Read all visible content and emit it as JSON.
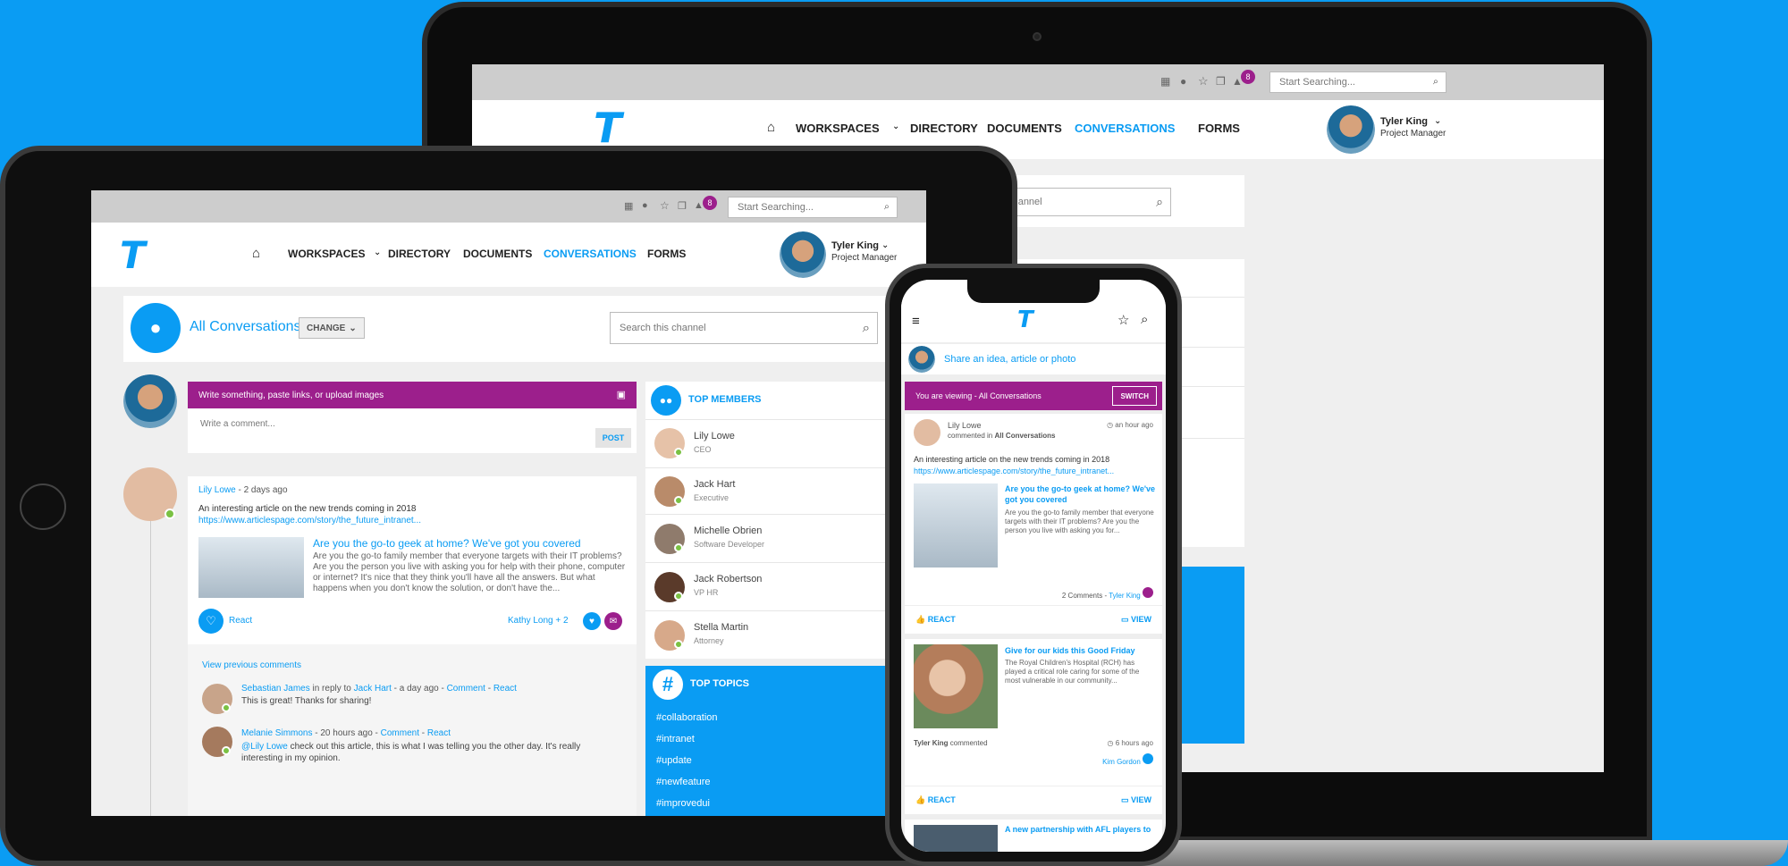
{
  "header": {
    "search_placeholder": "Start Searching...",
    "notification_count": "8",
    "nav": [
      "WORKSPACES",
      "DIRECTORY",
      "DOCUMENTS",
      "CONVERSATIONS",
      "FORMS"
    ],
    "active_nav": "CONVERSATIONS",
    "user_name": "Tyler King",
    "user_role": "Project Manager"
  },
  "channel": {
    "title": "All Conversations",
    "change_label": "CHANGE",
    "search_placeholder": "Search this channel"
  },
  "composer": {
    "prompt": "Write something, paste links, or upload images",
    "comment_placeholder": "Write a comment...",
    "post_label": "POST"
  },
  "post": {
    "author": "Lily Lowe",
    "time": " - 2 days ago",
    "text": "An interesting article on the new trends coming in 2018",
    "url": "https://www.articlespage.com/story/the_future_intranet...",
    "article_title": "Are you the go-to geek at home? We've got you covered",
    "article_body": "Are you the go-to family member that everyone targets with their IT problems? Are you the person you live with asking you for help with their phone, computer or internet? It's nice that they think you'll have all the answers. But what happens when you don't know the solution, or don't have the...",
    "react_label": "React",
    "reactors": "Kathy Long + 2",
    "view_previous": "View previous comments",
    "comments": [
      {
        "author": "Sebastian James",
        "reply_text": " in reply to ",
        "reply_to": "Jack Hart",
        "meta": " - a day ago - ",
        "comment_link": "Comment",
        "dash": " - ",
        "react_link": "React",
        "text": "This is great! Thanks for sharing!"
      },
      {
        "author": "Melanie Simmons",
        "meta": " - 20 hours ago - ",
        "comment_link": "Comment",
        "dash": " - ",
        "react_link": "React",
        "mention": "@Lily Lowe",
        "text": " check out this article, this is what I was telling you the other day. It's really interesting in my opinion."
      }
    ]
  },
  "top_members": {
    "title": "TOP MEMBERS",
    "members": [
      {
        "name": "Lily Lowe",
        "role": "CEO"
      },
      {
        "name": "Jack Hart",
        "role": "Executive"
      },
      {
        "name": "Michelle Obrien",
        "role": "Software Developer"
      },
      {
        "name": "Jack Robertson",
        "role": "VP HR"
      },
      {
        "name": "Stella Martin",
        "role": "Attorney"
      }
    ]
  },
  "top_topics": {
    "title": "TOP TOPICS",
    "topics": [
      "#collaboration",
      "#intranet",
      "#update",
      "#newfeature",
      "#improvedui"
    ]
  },
  "mobile": {
    "share_prompt": "Share an idea, article or photo",
    "viewing_text": "You are viewing - All Conversations",
    "switch_label": "SWITCH",
    "post1": {
      "author": "Lily Lowe",
      "action": "commented in ",
      "channel": "All Conversations",
      "time": "an hour ago",
      "text": "An interesting article on the new trends coming in 2018",
      "url": "https://www.articlespage.com/story/the_future_intranet...",
      "article_title": "Are you the go-to geek at home? We've got you covered",
      "article_body": "Are you the go-to family member that everyone targets with their IT problems? Are you the person you live with asking you for...",
      "comments": "2 Comments - ",
      "commenter": "Tyler King"
    },
    "react_label": "REACT",
    "view_label": "VIEW",
    "post2": {
      "article_title": "Give for our kids this Good Friday",
      "article_body": "The Royal Children's Hospital (RCH) has played a critical role caring for some of the most vulnerable in our community...",
      "commenter": "Tyler King",
      "action": " commented",
      "time": "6 hours ago",
      "reactor": "Kim Gordon"
    },
    "post3": {
      "article_title": "A new partnership with AFL players to"
    }
  },
  "colors": {
    "accent": "#0a9cf3",
    "purple": "#9c1f8c",
    "online": "#7ac143"
  }
}
